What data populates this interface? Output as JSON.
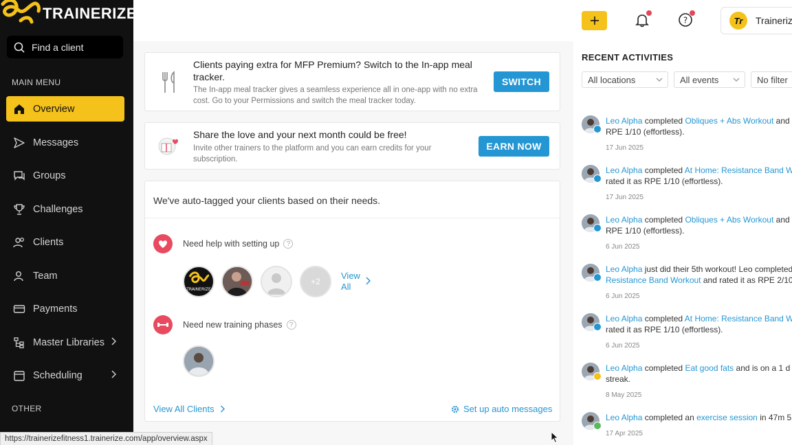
{
  "brand": {
    "name": "TRAINERIZE",
    "accent": "#f5c21b",
    "link_color": "#2496d3"
  },
  "search": {
    "placeholder": "Find a client",
    "icon": "search-icon"
  },
  "sidebar": {
    "main_menu_label": "MAIN MENU",
    "other_label": "OTHER",
    "items": [
      {
        "label": "Overview",
        "icon": "home-icon",
        "active": true
      },
      {
        "label": "Messages",
        "icon": "send-icon"
      },
      {
        "label": "Groups",
        "icon": "chat-icon"
      },
      {
        "label": "Challenges",
        "icon": "trophy-icon"
      },
      {
        "label": "Clients",
        "icon": "users-icon"
      },
      {
        "label": "Team",
        "icon": "team-icon"
      },
      {
        "label": "Payments",
        "icon": "card-icon"
      },
      {
        "label": "Master Libraries",
        "icon": "tree-icon",
        "expandable": true
      },
      {
        "label": "Scheduling",
        "icon": "calendar-icon",
        "expandable": true
      }
    ]
  },
  "topbar": {
    "add_label": "+",
    "account_name": "Trainerize",
    "account_initials": "Tr"
  },
  "banners": {
    "meal": {
      "title": "Clients paying extra for MFP Premium? Switch to the In-app meal tracker.",
      "description": "The In-app meal tracker gives a seamless experience all in one-app with no extra cost. Go to your Permissions and switch the meal tracker today.",
      "button": "SWITCH"
    },
    "referral": {
      "title": "Share the love and your next month could be free!",
      "description": "Invite other trainers to the platform and you can earn credits for your subscription.",
      "button": "EARN NOW"
    }
  },
  "auto_tag": {
    "heading": "We've auto-tagged your clients based on their needs.",
    "groups": [
      {
        "label": "Need help with setting up",
        "extra_count": "+2",
        "view_all": "View All"
      },
      {
        "label": "Need new training phases"
      }
    ],
    "view_all_clients": "View All Clients",
    "setup_messages": "Set up auto messages"
  },
  "activities": {
    "title": "RECENT ACTIVITIES",
    "filters": [
      "All locations",
      "All events",
      "No filter"
    ],
    "items": [
      {
        "name": "Leo Alpha",
        "mid": "completed",
        "link": "Obliques + Abs Workout",
        "rest": "and",
        "line2": "RPE 1/10 (effortless).",
        "date": "17 Jun 2025"
      },
      {
        "name": "Leo Alpha",
        "mid": "completed",
        "link": "At Home: Resistance Band W",
        "rest": "",
        "line2": "rated it as RPE 1/10 (effortless).",
        "date": "17 Jun 2025"
      },
      {
        "name": "Leo Alpha",
        "mid": "completed",
        "link": "Obliques + Abs Workout",
        "rest": "and",
        "line2": "RPE 1/10 (effortless).",
        "date": "6 Jun 2025"
      },
      {
        "name": "Leo Alpha",
        "mid": "just did their 5th workout! Leo completed",
        "link": "",
        "rest": "",
        "line2_link": "Resistance Band Workout",
        "line2": "and rated it as RPE 2/10",
        "date": "6 Jun 2025"
      },
      {
        "name": "Leo Alpha",
        "mid": "completed",
        "link": "At Home: Resistance Band W",
        "rest": "",
        "line2": "rated it as RPE 1/10 (effortless).",
        "date": "6 Jun 2025"
      },
      {
        "name": "Leo Alpha",
        "mid": "completed",
        "link": "Eat good fats",
        "rest": "and is on a 1 d",
        "line2": "streak.",
        "date": "8 May 2025"
      },
      {
        "name": "Leo Alpha",
        "mid": "completed an",
        "link": "exercise session",
        "rest": "in 47m 5",
        "line2": "",
        "date": "17 Apr 2025"
      }
    ]
  },
  "statusbar": {
    "url": "https://trainerizefitness1.trainerize.com/app/overview.aspx"
  }
}
